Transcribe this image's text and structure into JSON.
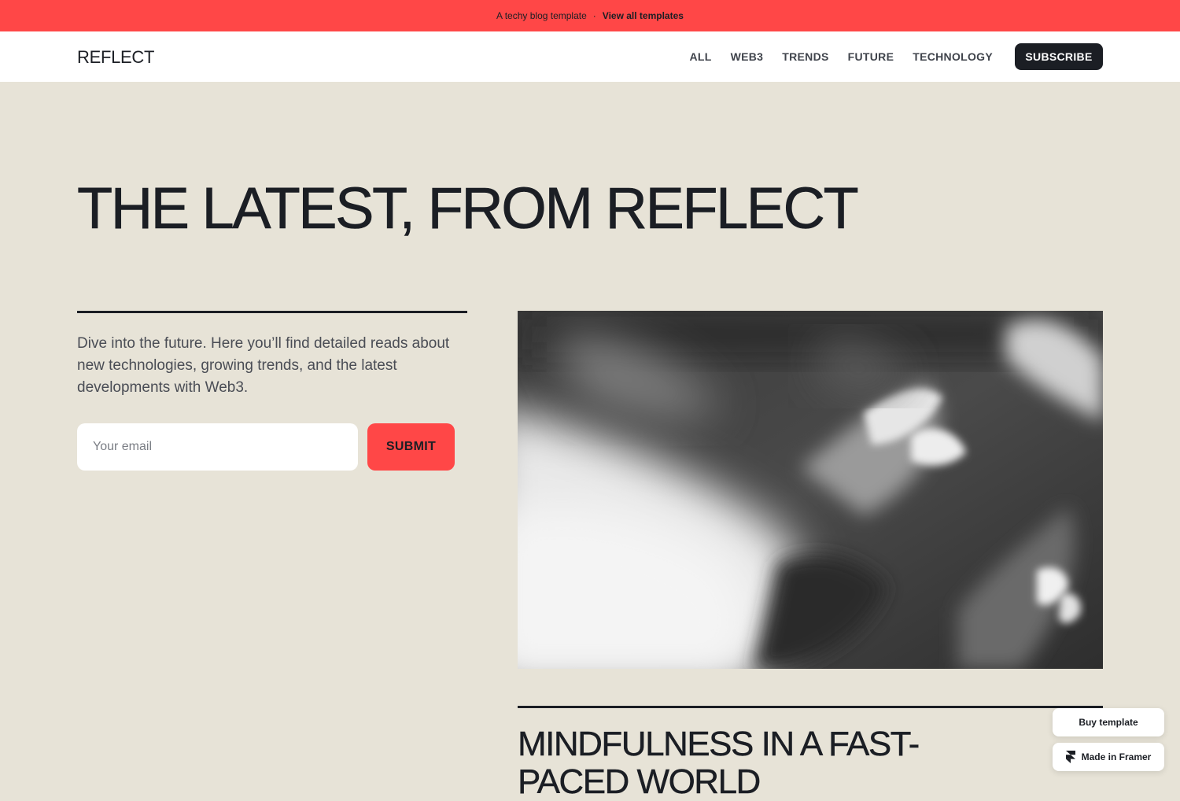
{
  "announcement": {
    "text": "A techy blog template",
    "separator": "·",
    "link_label": "View all templates"
  },
  "header": {
    "logo": "REFLECT",
    "nav": [
      "ALL",
      "WEB3",
      "TRENDS",
      "FUTURE",
      "TECHNOLOGY"
    ],
    "subscribe_label": "SUBSCRIBE"
  },
  "hero": {
    "title": "THE LATEST, FROM REFLECT",
    "intro": "Dive into the future. Here you’ll find detailed reads about new technologies, growing trends, and the latest developments with Web3.",
    "email_placeholder": "Your email",
    "submit_label": "SUBMIT"
  },
  "featured": {
    "title": "MINDFULNESS IN A FAST-PACED WORLD"
  },
  "floating": {
    "buy_label": "Buy template",
    "framer_label": "Made in Framer",
    "framer_icon": "framer-logo-icon"
  },
  "colors": {
    "accent": "#ff4747",
    "background": "#e7e3d7",
    "ink": "#1b1e24"
  }
}
